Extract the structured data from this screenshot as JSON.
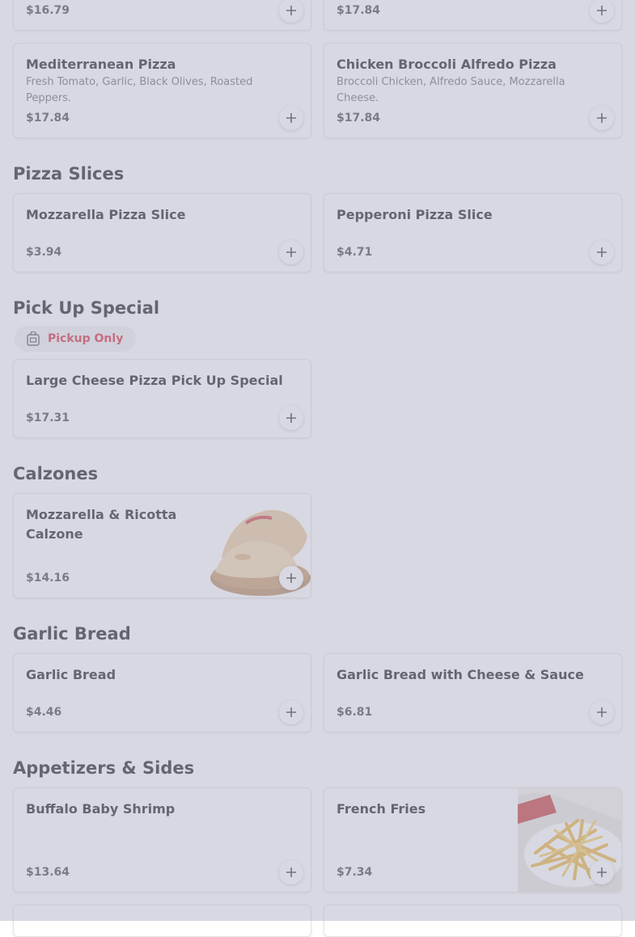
{
  "top_row": {
    "left_price": "$16.79",
    "right_price": "$17.84"
  },
  "pizzas": {
    "mediterranean": {
      "name": "Mediterranean Pizza",
      "description": "Fresh Tomato, Garlic, Black Olives, Roasted Peppers.",
      "price": "$17.84"
    },
    "chicken_broccoli": {
      "name": "Chicken Broccoli Alfredo Pizza",
      "description": "Broccoli Chicken, Alfredo Sauce, Mozzarella Cheese.",
      "price": "$17.84"
    }
  },
  "sections": {
    "pizza_slices": "Pizza Slices",
    "pick_up_special": "Pick Up Special",
    "calzones": "Calzones",
    "garlic_bread": "Garlic Bread",
    "appetizers": "Appetizers & Sides"
  },
  "pizza_slices": [
    {
      "name": "Mozzarella Pizza Slice",
      "price": "$3.94"
    },
    {
      "name": "Pepperoni Pizza Slice",
      "price": "$4.71"
    }
  ],
  "pickup_badge": "Pickup Only",
  "pick_up_special": [
    {
      "name": "Large Cheese Pizza Pick Up Special",
      "price": "$17.31"
    }
  ],
  "calzones": [
    {
      "name": "Mozzarella & Ricotta Calzone",
      "price": "$14.16"
    }
  ],
  "garlic_bread": [
    {
      "name": "Garlic Bread",
      "price": "$4.46"
    },
    {
      "name": "Garlic Bread with Cheese & Sauce",
      "price": "$6.81"
    }
  ],
  "appetizers": [
    {
      "name": "Buffalo Baby Shrimp",
      "price": "$13.64"
    },
    {
      "name": "French Fries",
      "price": "$7.34"
    }
  ],
  "icons": {
    "add": "plus-icon",
    "pickup": "bag-icon"
  },
  "colors": {
    "overlay": "#b2b2c6",
    "pickup_accent": "#d62b3d"
  }
}
